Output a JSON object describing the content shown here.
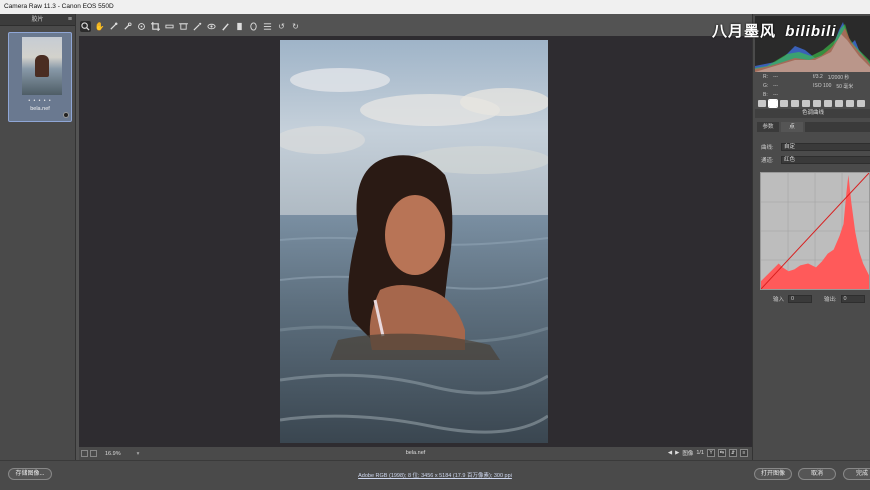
{
  "window": {
    "title": "Camera Raw 11.3  -  Canon EOS 550D"
  },
  "filmstrip": {
    "header": "胶片",
    "thumb_name": "bela.nef",
    "thumb_rating": "• • • • •"
  },
  "toolbar": {
    "tools": [
      "zoom-icon",
      "hand-icon",
      "white-balance-icon",
      "color-sampler-icon",
      "target-adjust-icon",
      "crop-icon",
      "straighten-icon",
      "transform-icon",
      "spot-removal-icon",
      "red-eye-icon",
      "adjustment-brush-icon",
      "graduated-filter-icon",
      "radial-filter-icon",
      "preferences-icon",
      "rotate-left-icon",
      "rotate-right-icon"
    ]
  },
  "canvas": {
    "file_name": "bela.nef",
    "zoom": "16.9%",
    "page": "1/1",
    "view_label": "图像"
  },
  "watermark": "八月墨风",
  "watermark_logo": "bilibili",
  "camera_info": {
    "aperture": "f/3.2",
    "shutter": "1/2000 秒",
    "iso": "ISO 100",
    "focal": "50 毫米",
    "r_label": "R:",
    "g_label": "G:",
    "b_label": "B:",
    "r_value": "---",
    "g_value": "---",
    "b_value": "---"
  },
  "panel": {
    "title": "色调曲线",
    "subtab_parametric": "参数",
    "subtab_point": "点",
    "curve_label": "曲线:",
    "curve_value": "自定",
    "channel_label": "通道:",
    "channel_value": "红色",
    "input_label": "输入",
    "input_value": "0",
    "output_label": "输出:",
    "output_value": "0"
  },
  "bottom": {
    "save_label": "存储图像...",
    "workflow": "Adobe RGB (1998); 8 位; 3456 x 5184 (17.9 百万像素); 300 ppi",
    "open_label": "打开图像",
    "cancel_label": "取消",
    "done_label": "完成"
  },
  "colors": {
    "accent": "#8fa6d6",
    "curve_fill": "#ff5a5a",
    "panel_bg": "#4b4b4b",
    "canvas_bg": "#2e2c30"
  }
}
